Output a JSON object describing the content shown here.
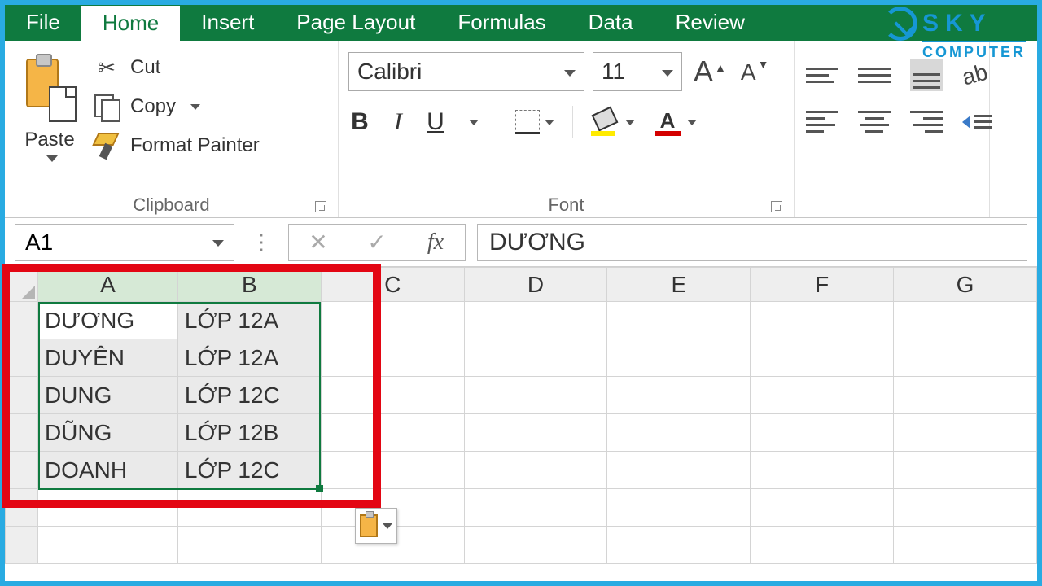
{
  "tabs": {
    "file": "File",
    "home": "Home",
    "insert": "Insert",
    "pagelayout": "Page Layout",
    "formulas": "Formulas",
    "data": "Data",
    "review": "Review"
  },
  "ribbon": {
    "clipboard": {
      "paste": "Paste",
      "cut": "Cut",
      "copy": "Copy",
      "format_painter": "Format Painter",
      "group_label": "Clipboard"
    },
    "font": {
      "name": "Calibri",
      "size": "11",
      "group_label": "Font"
    }
  },
  "formula_bar": {
    "name_box": "A1",
    "fx_label": "fx",
    "value": "DƯƠNG"
  },
  "columns": [
    "A",
    "B",
    "C",
    "D",
    "E",
    "F",
    "G"
  ],
  "cells": {
    "a1": "DƯƠNG",
    "b1": "LỚP 12A",
    "a2": "DUYÊN",
    "b2": "LỚP 12A",
    "a3": "DUNG",
    "b3": "LỚP 12C",
    "a4": "DŨNG",
    "b4": "LỚP 12B",
    "a5": "DOANH",
    "b5": "LỚP 12C"
  },
  "watermark": {
    "line1": "SKY",
    "line2": "COMPUTER"
  }
}
